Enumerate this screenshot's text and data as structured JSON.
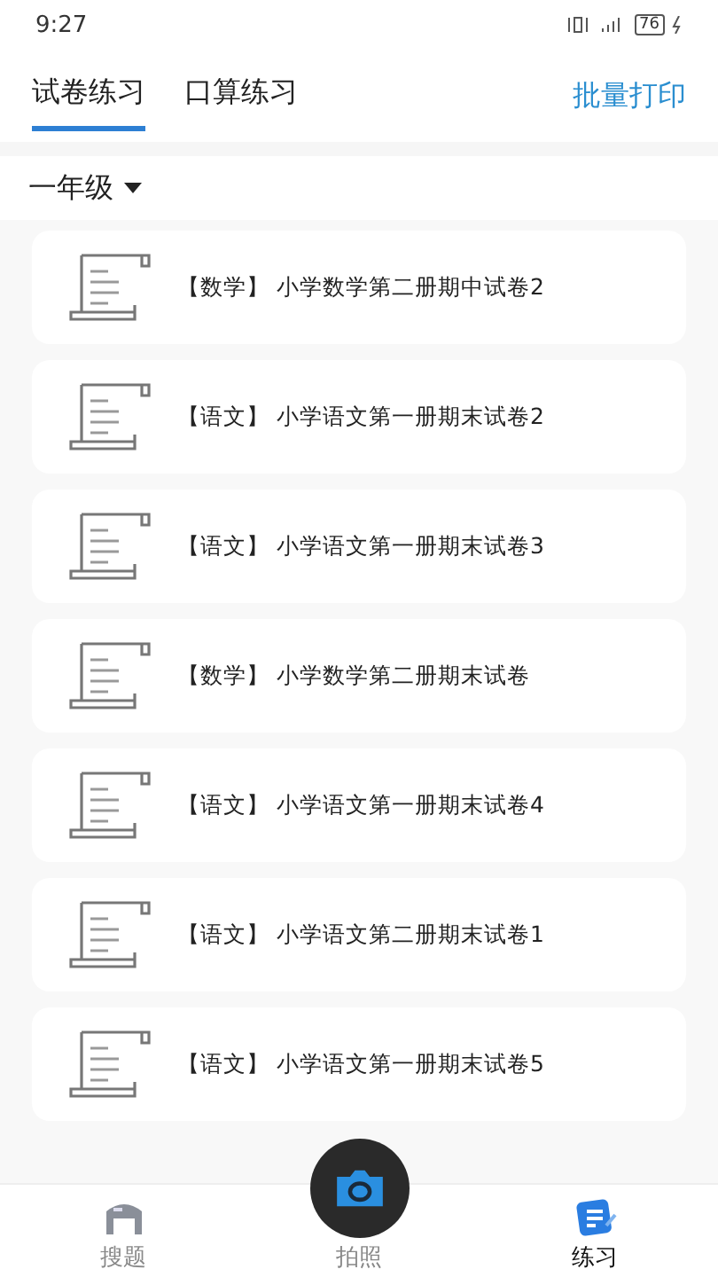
{
  "status_bar": {
    "time": "9:27",
    "battery": "76"
  },
  "tabs": [
    {
      "label": "试卷练习",
      "selected": true
    },
    {
      "label": "口算练习",
      "selected": false
    }
  ],
  "action": "批量打印",
  "grade_filter": {
    "value": "一年级"
  },
  "papers": [
    {
      "subject": "【数学】",
      "title": "小学数学第二册期中试卷2"
    },
    {
      "subject": "【语文】",
      "title": "小学语文第一册期末试卷2"
    },
    {
      "subject": "【语文】",
      "title": "小学语文第一册期末试卷3"
    },
    {
      "subject": "【数学】",
      "title": "小学数学第二册期末试卷"
    },
    {
      "subject": "【语文】",
      "title": "小学语文第一册期末试卷4"
    },
    {
      "subject": "【语文】",
      "title": "小学语文第二册期末试卷1"
    },
    {
      "subject": "【语文】",
      "title": "小学语文第一册期末试卷5"
    }
  ],
  "bottom_nav": [
    {
      "label": "搜题",
      "kind": "search",
      "selected": false
    },
    {
      "label": "拍照",
      "kind": "camera",
      "selected": false
    },
    {
      "label": "练习",
      "kind": "practice",
      "selected": true
    }
  ]
}
